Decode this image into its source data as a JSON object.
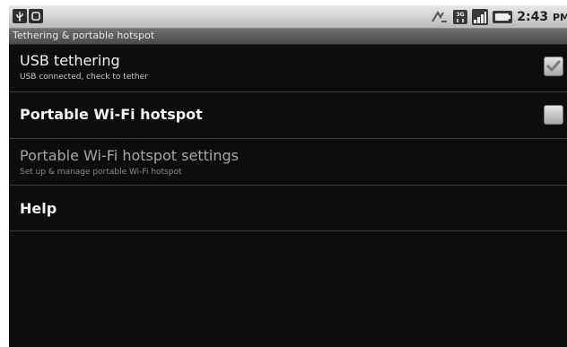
{
  "status_bar": {
    "time": "2:43",
    "ampm": "PM",
    "left_icons": [
      "usb-icon",
      "notification-icon"
    ],
    "right_icons": [
      "sync-icon",
      "3g-icon",
      "signal-icon",
      "battery-icon"
    ]
  },
  "title_bar": {
    "title": "Tethering & portable hotspot"
  },
  "settings": {
    "items": [
      {
        "title": "USB tethering",
        "summary": "USB connected, check to tether",
        "checked": true,
        "enabled": true
      },
      {
        "title": "Portable Wi-Fi hotspot",
        "summary": "",
        "checked": false,
        "enabled": true
      },
      {
        "title": "Portable Wi-Fi hotspot settings",
        "summary": "Set up & manage portable Wi-Fi hotspot",
        "enabled": false
      },
      {
        "title": "Help",
        "summary": ""
      }
    ]
  }
}
